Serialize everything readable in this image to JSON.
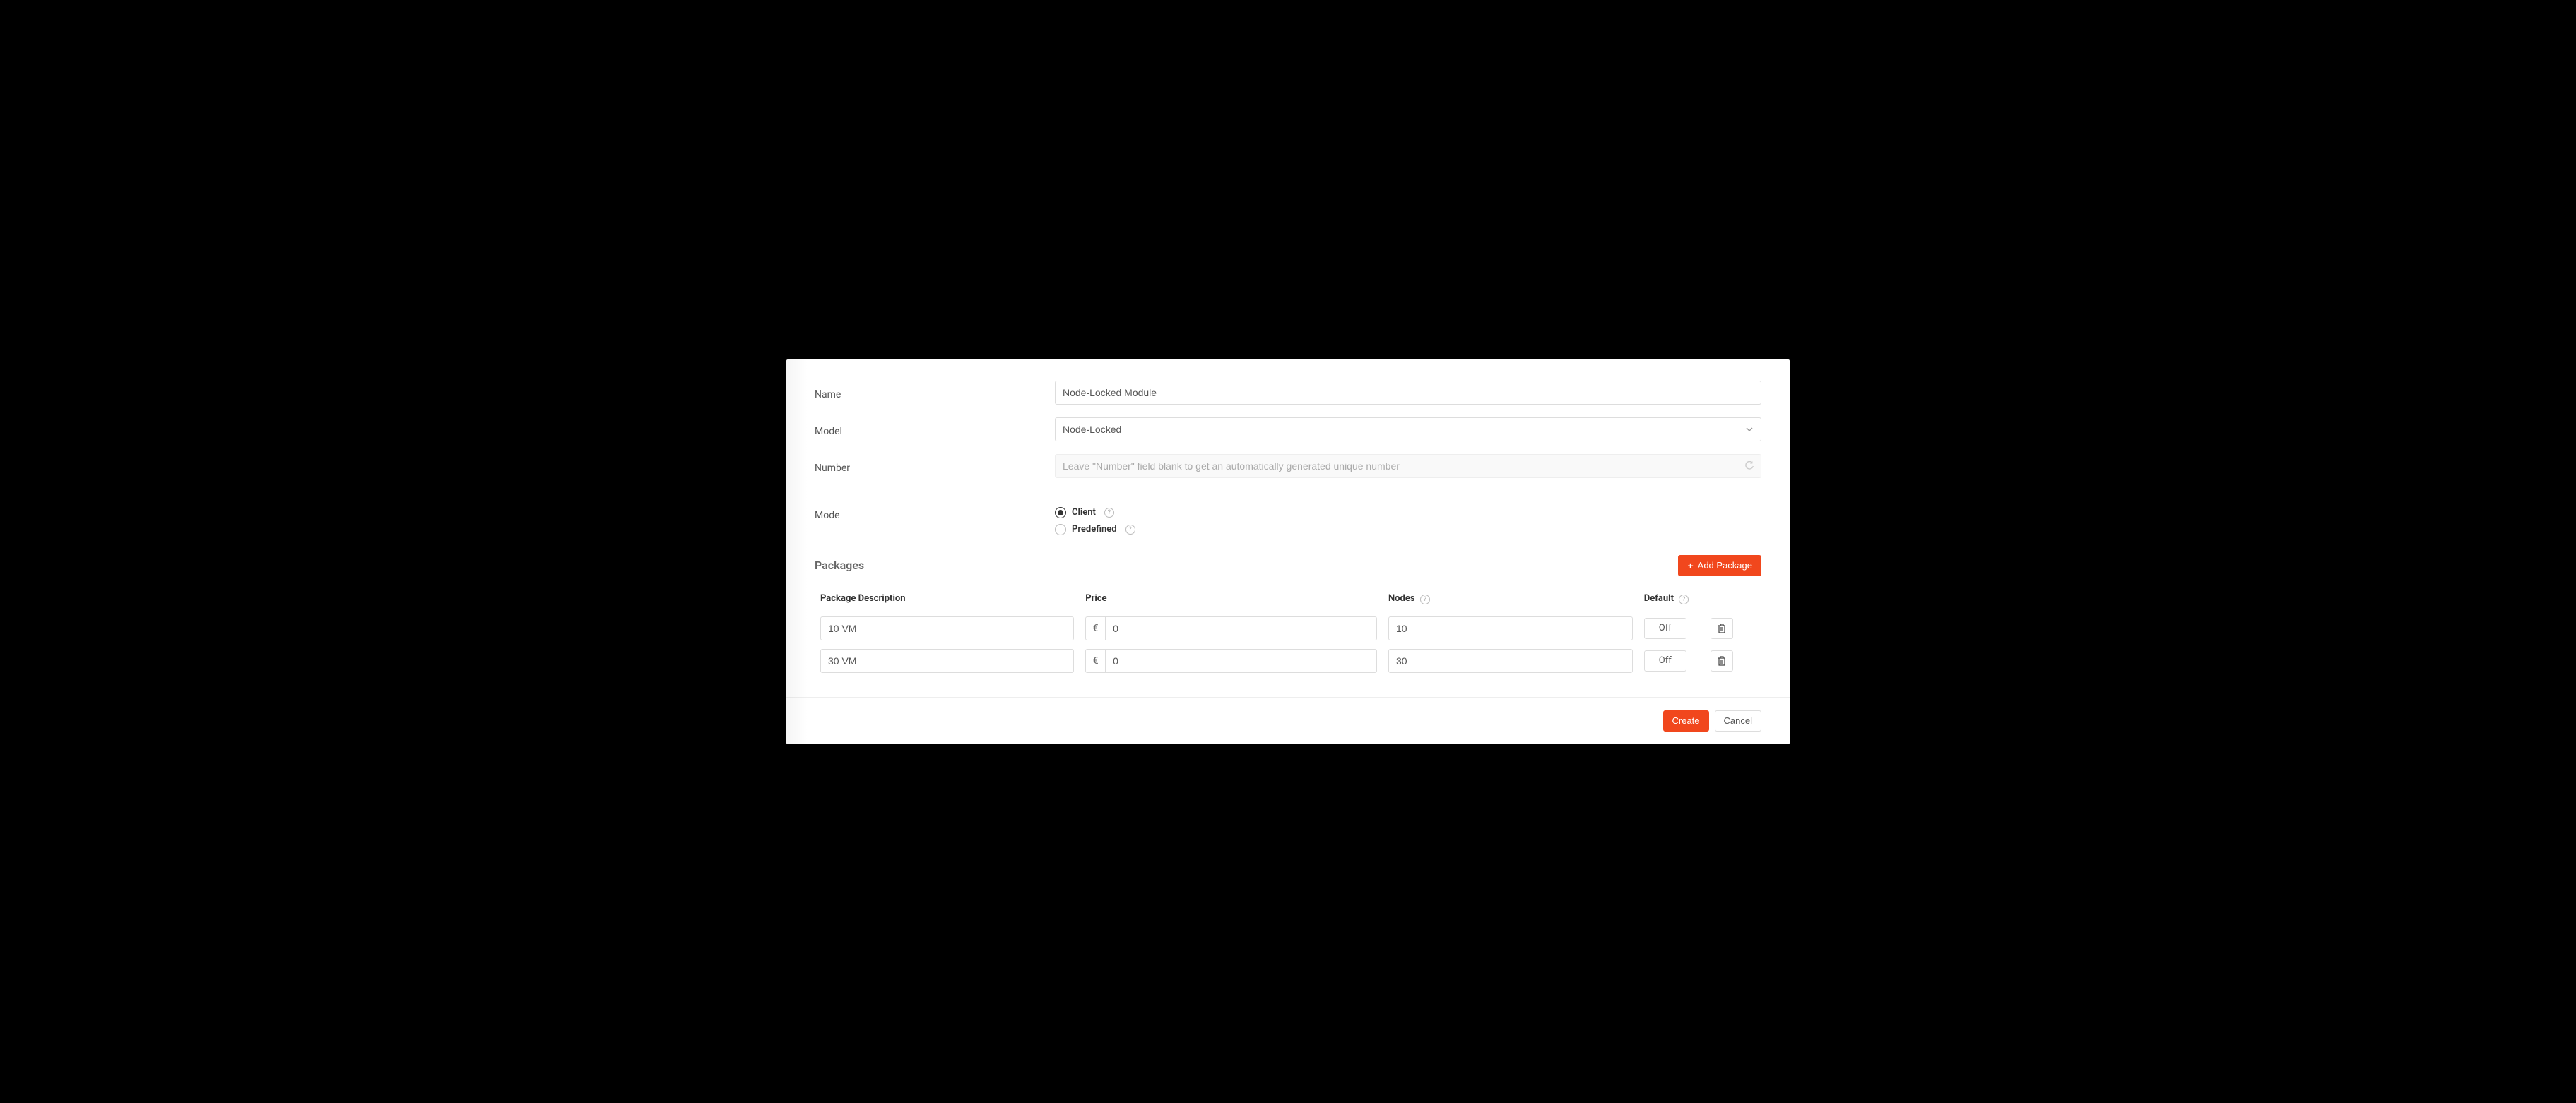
{
  "form": {
    "name": {
      "label": "Name",
      "value": "Node-Locked Module"
    },
    "model": {
      "label": "Model",
      "value": "Node-Locked"
    },
    "number": {
      "label": "Number",
      "placeholder": "Leave \"Number\" field blank to get an automatically generated unique number"
    },
    "mode": {
      "label": "Mode",
      "options": [
        {
          "label": "Client",
          "checked": true
        },
        {
          "label": "Predefined",
          "checked": false
        }
      ]
    }
  },
  "packages": {
    "title": "Packages",
    "add_label": "Add Package",
    "columns": {
      "description": "Package Description",
      "price": "Price",
      "nodes": "Nodes",
      "default": "Default"
    },
    "currency": "€",
    "toggle_off": "Off",
    "rows": [
      {
        "description": "10 VM",
        "price": "0",
        "nodes": "10",
        "default": "Off"
      },
      {
        "description": "30 VM",
        "price": "0",
        "nodes": "30",
        "default": "Off"
      }
    ]
  },
  "footer": {
    "create": "Create",
    "cancel": "Cancel"
  }
}
